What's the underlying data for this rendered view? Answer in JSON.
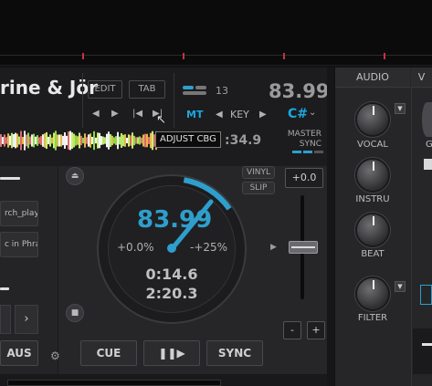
{
  "deck": {
    "title": "rine & Jör",
    "edit_label": "EDIT",
    "tab_label": "TAB",
    "loop_count": "13",
    "bpm": "83.99",
    "mt_label": "MT",
    "key_label": "KEY",
    "key_value": "C#",
    "remaining_time": ":34.9",
    "master_label": "MASTER",
    "sync_label": "SYNC",
    "tooltip": "ADJUST CBG"
  },
  "left_panel": {
    "playlist_label": "rch_playlists",
    "phrase_label": "c in Phrase",
    "aus_label": "AUS"
  },
  "jog": {
    "bpm": "83.99",
    "pitch": "+0.0%",
    "range": "-+25%",
    "elapsed": "0:14.6",
    "total": "2:20.3"
  },
  "pitch": {
    "vinyl_label": "VINYL",
    "slip_label": "SLIP",
    "value": "+0.0",
    "minus_label": "-",
    "plus_label": "+"
  },
  "transport": {
    "cue_label": "CUE",
    "play_label": "❚❚▶",
    "sync_label": "SYNC"
  },
  "mixer": {
    "tab_audio": "AUDIO",
    "tab_v": "V",
    "knobs": [
      "VOCAL",
      "INSTRU",
      "BEAT",
      "FILTER"
    ],
    "g_label": "G"
  },
  "colors": {
    "accent": "#2e9fcc",
    "marker": "#c8323c"
  }
}
